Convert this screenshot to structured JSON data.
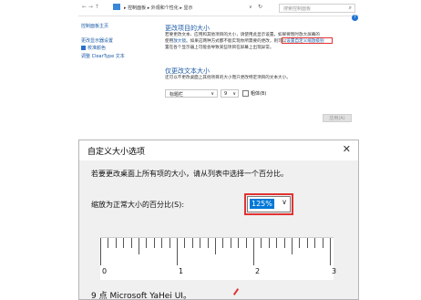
{
  "colors": {
    "link": "#1a5aa6",
    "highlight_red": "#e23232",
    "selected_blue": "#0078d7",
    "dialog_bg": "#f0f0f0"
  },
  "control_panel": {
    "nav_glyphs": "← → ↑",
    "breadcrumb": "▸ 控制面板 ▸ 外观和个性化 ▸ 显示",
    "search_placeholder": "搜索控制面板",
    "sidebar": {
      "home": "控制面板主页",
      "resolution": "更改显示器设置",
      "calibrate": "校准颜色",
      "cleartype": "调整 ClearType 文本"
    },
    "section1": {
      "heading": "更改项目的大小",
      "line1": "若要更改文本、应用和其他项目的大小，请使用此显示设置。如果要暂时放大屏幕的",
      "line2_a": "使用",
      "line2_link": "放大镜",
      "line2_b": "。如果这两种方式都不能实现你所需要的更改，则可以",
      "line2_highlight": "设置自定义缩放级别",
      "line3": "置在各个显示器上可能会导致某些项目在屏幕上出现异常。"
    },
    "section2": {
      "heading": "仅更改文本大小",
      "line1": "还可以不更改桌面上其他项目的大小而只更改特定项目的文本大小。",
      "item_select": "标题栏",
      "size_select": "9",
      "bold_label": "粗体(B)"
    },
    "apply_button": "应用(A)"
  },
  "dialog": {
    "title": "自定义大小选项",
    "instruction": "若要更改桌面上所有项的大小，请从列表中选择一个百分比。",
    "scale_label": "缩放为正常大小的百分比(S):",
    "scale_value": "125%",
    "ruler_labels": [
      "0",
      "1",
      "2",
      "3"
    ],
    "sample_text": "9 点 Microsoft YaHei UI。"
  }
}
